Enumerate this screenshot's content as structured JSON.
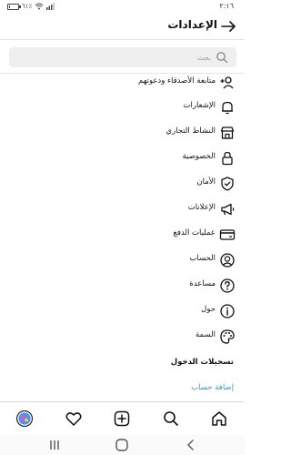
{
  "status_bar": {
    "time": "٢:١٦",
    "battery_text": "٦١٪",
    "battery_level_percent": 16
  },
  "header": {
    "title": "الإعدادات"
  },
  "search": {
    "placeholder": "بحث"
  },
  "menu": [
    {
      "label": "متابعة الأصدقاء ودعوتهم",
      "icon": "add-person-icon"
    },
    {
      "label": "الإشعارات",
      "icon": "bell-icon"
    },
    {
      "label": "النشاط التجاري",
      "icon": "shop-icon"
    },
    {
      "label": "الخصوصية",
      "icon": "lock-icon"
    },
    {
      "label": "الأمان",
      "icon": "shield-check-icon"
    },
    {
      "label": "الإعلانات",
      "icon": "megaphone-icon"
    },
    {
      "label": "عمليات الدفع",
      "icon": "credit-card-icon"
    },
    {
      "label": "الحساب",
      "icon": "account-circle-icon"
    },
    {
      "label": "مساعدة",
      "icon": "help-icon"
    },
    {
      "label": "حول",
      "icon": "info-icon"
    },
    {
      "label": "السمة",
      "icon": "palette-icon"
    }
  ],
  "logins": {
    "heading": "تسجيلات الدخول",
    "add_account": "إضافة حساب"
  },
  "tab_bar": {
    "items": [
      "home-icon",
      "search-icon",
      "new-post-icon",
      "heart-icon",
      "profile-avatar"
    ]
  },
  "system_nav": {
    "items": [
      "back-icon",
      "home-button-icon",
      "recent-apps-icon"
    ]
  },
  "colors": {
    "link": "#1d9bf0",
    "text": "#111111",
    "search_bg": "#efefef"
  }
}
